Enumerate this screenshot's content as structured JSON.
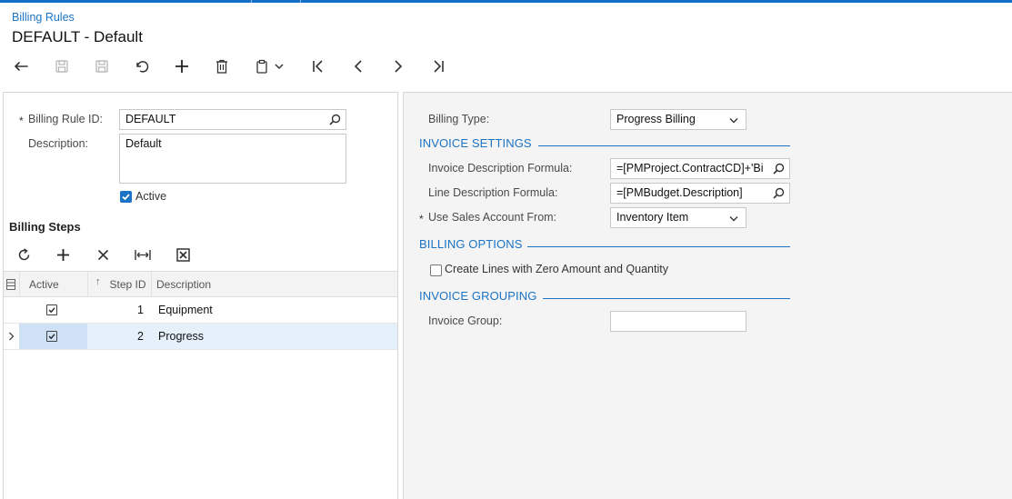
{
  "breadcrumb": "Billing Rules",
  "title": "DEFAULT - Default",
  "toolbar": {
    "buttons": [
      "back-arrow-icon",
      "save-close-icon",
      "save-icon",
      "undo-icon",
      "add-icon",
      "delete-icon",
      "copy-paste-icon",
      "chevron-down-icon",
      "first-record-icon",
      "previous-record-icon",
      "next-record-icon",
      "last-record-icon"
    ]
  },
  "form": {
    "billing_rule_id_label": "Billing Rule ID:",
    "billing_rule_id_value": "DEFAULT",
    "description_label": "Description:",
    "description_value": "Default",
    "active_label": "Active",
    "active_checked": true
  },
  "billing_steps": {
    "title": "Billing Steps",
    "toolbar": [
      "refresh-icon",
      "add-icon",
      "delete-icon",
      "fit-columns-icon",
      "export-excel-icon"
    ],
    "columns": {
      "active": "Active",
      "step_id": "Step ID",
      "description": "Description",
      "sort_indicator": "↑"
    },
    "rows": [
      {
        "active": true,
        "step_id": "1",
        "description": "Equipment",
        "selected": false
      },
      {
        "active": true,
        "step_id": "2",
        "description": "Progress",
        "selected": true
      }
    ]
  },
  "right": {
    "billing_type_label": "Billing Type:",
    "billing_type_value": "Progress Billing",
    "invoice_settings_title": "INVOICE SETTINGS",
    "invoice_desc_formula_label": "Invoice Description Formula:",
    "invoice_desc_formula_value": "=[PMProject.ContractCD]+'Bi",
    "line_desc_formula_label": "Line Description Formula:",
    "line_desc_formula_value": "=[PMBudget.Description]",
    "use_sales_account_label": "Use Sales Account From:",
    "use_sales_account_value": "Inventory Item",
    "billing_options_title": "BILLING OPTIONS",
    "create_lines_label": "Create Lines with Zero Amount and Quantity",
    "create_lines_checked": false,
    "invoice_grouping_title": "INVOICE GROUPING",
    "invoice_group_label": "Invoice Group:",
    "invoice_group_value": ""
  },
  "colors": {
    "accent": "#1a73c4",
    "topbar": "#1470c7",
    "selected_row": "#e5f0fb",
    "right_pane_bg": "#f4f4f4"
  }
}
